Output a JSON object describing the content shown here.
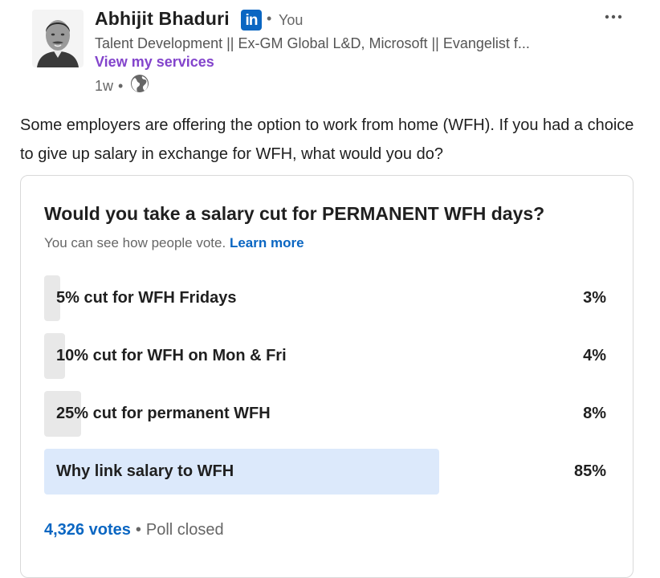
{
  "author": {
    "name": "Abhijit Bhaduri",
    "badge": "in",
    "relation": "You",
    "headline": "Talent Development || Ex-GM Global L&D, Microsoft || Evangelist f...",
    "services_link": "View my services",
    "time_posted": "1w",
    "visibility_icon": "globe-icon",
    "more_icon": "more-icon"
  },
  "post": {
    "text": "Some employers are offering the option to work from home (WFH). If you had a choice to give up salary in exchange for WFH, what would you do?"
  },
  "poll": {
    "question": "Would you take a salary cut for PERMANENT WFH days?",
    "visibility_text": "You can see how people vote.",
    "learn_more": "Learn more",
    "options": [
      {
        "label": "5% cut for WFH Fridays",
        "percent_text": "3%",
        "percent": 3,
        "selected": false
      },
      {
        "label": "10% cut for WFH on Mon & Fri",
        "percent_text": "4%",
        "percent": 4,
        "selected": false
      },
      {
        "label": "25% cut for permanent WFH",
        "percent_text": "8%",
        "percent": 8,
        "selected": false
      },
      {
        "label": "Why link salary to WFH",
        "percent_text": "85%",
        "percent": 85,
        "selected": true
      }
    ],
    "votes": "4,326 votes",
    "status": "Poll closed"
  },
  "colors": {
    "brand_blue": "#0a66c2",
    "services_purple": "#8344cc",
    "option_fill": "#e8e8e8",
    "option_fill_selected": "#dce9fb"
  }
}
